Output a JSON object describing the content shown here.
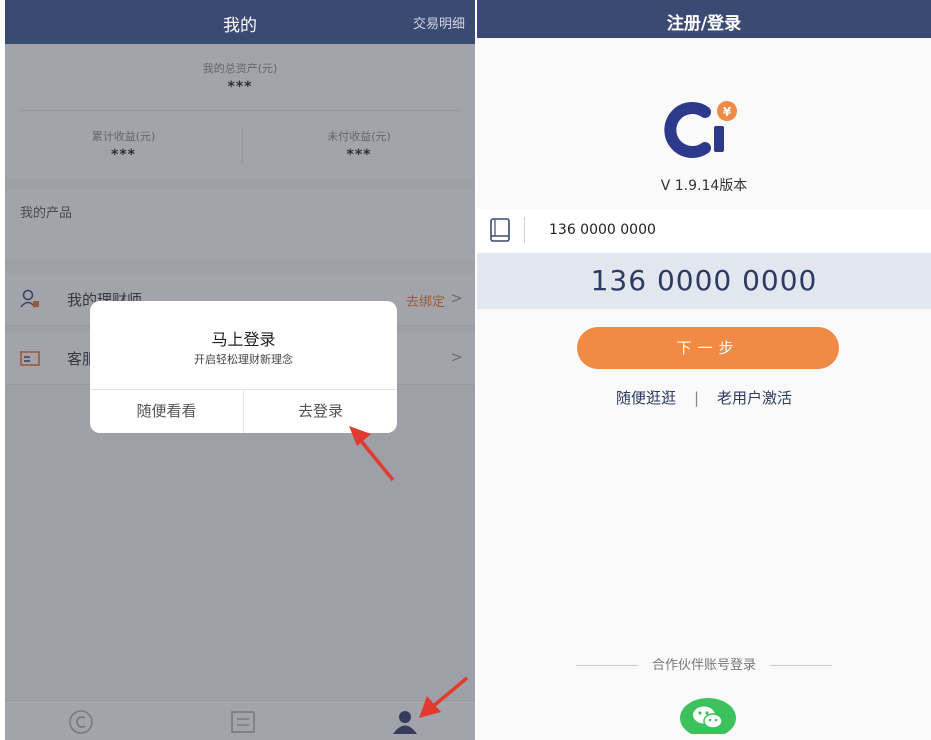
{
  "left": {
    "header": {
      "title": "我的",
      "right_link": "交易明细"
    },
    "assets": {
      "total_label": "我的总资产(元)",
      "total_value": "***",
      "cumulative_label": "累计收益(元)",
      "cumulative_value": "***",
      "unpaid_label": "未付收益(元)",
      "unpaid_value": "***"
    },
    "products_label": "我的产品",
    "menu": [
      {
        "label": "我的理财师",
        "action": "去绑定",
        "chevron": ">"
      },
      {
        "label": "客服",
        "chevron": ">"
      }
    ],
    "tabs": [
      "home-icon",
      "product-icon",
      "user-icon"
    ],
    "dialog": {
      "title": "马上登录",
      "subtitle": "开启轻松理财新理念",
      "cancel": "随便看看",
      "confirm": "去登录"
    }
  },
  "right": {
    "header": {
      "title": "注册/登录"
    },
    "logo": {
      "name": "ci-logo-icon",
      "badge": "¥"
    },
    "version": "V 1.9.14版本",
    "phone_input": {
      "value": "136 0000 0000",
      "icon": "phone-icon"
    },
    "phone_display": "136 0000 0000",
    "next_button": "下一步",
    "links": {
      "browse": "随便逛逛",
      "separator": "|",
      "activate": "老用户激活"
    },
    "partner_label": "合作伙伴账号登录",
    "wechat_icon": "wechat-icon"
  },
  "colors": {
    "header_bg": "#3b4a72",
    "accent_orange": "#f08a45",
    "link_orange": "#e8742c",
    "wechat_green": "#3cc15c",
    "arrow_red": "#e23a2e"
  }
}
